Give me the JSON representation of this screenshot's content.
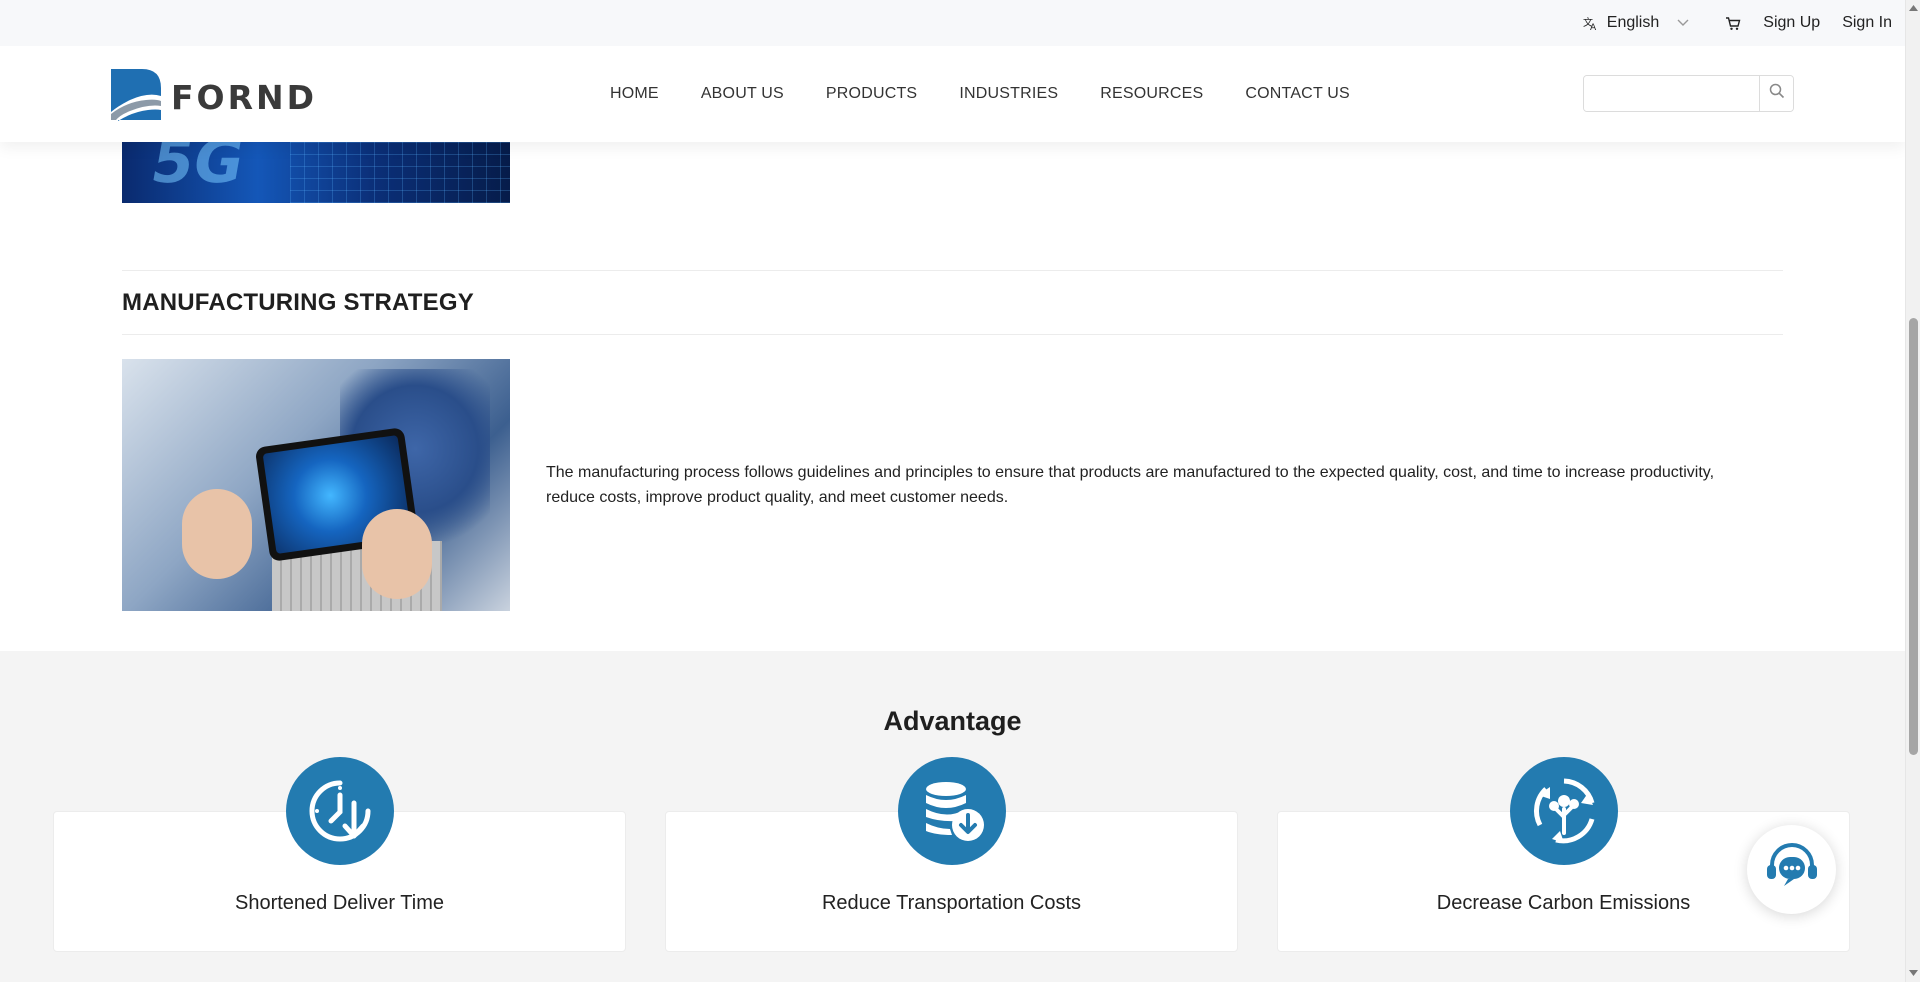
{
  "utility": {
    "language": "English",
    "sign_up": "Sign Up",
    "sign_in": "Sign In"
  },
  "header": {
    "logo_text": "FORND",
    "nav": [
      "HOME",
      "ABOUT US",
      "PRODUCTS",
      "INDUSTRIES",
      "RESOURCES",
      "CONTACT US"
    ],
    "search_placeholder": ""
  },
  "previous_section": {
    "image_text": "5G"
  },
  "manufacturing": {
    "title": "MANUFACTURING STRATEGY",
    "description": "The manufacturing process follows guidelines and principles to ensure that products are manufactured to the expected quality, cost, and time to increase productivity, reduce costs, improve product quality, and meet customer needs."
  },
  "advantage": {
    "title": "Advantage",
    "items": [
      {
        "label": "Shortened Deliver Time",
        "icon": "clock-arrow-icon"
      },
      {
        "label": "Reduce Transportation Costs",
        "icon": "database-download-icon"
      },
      {
        "label": "Decrease Carbon Emissions",
        "icon": "recycle-tree-icon"
      }
    ]
  },
  "colors": {
    "accent_blue": "#237bb0",
    "logo_blue": "#1f6fb2",
    "band_bg": "#f4f4f4"
  }
}
